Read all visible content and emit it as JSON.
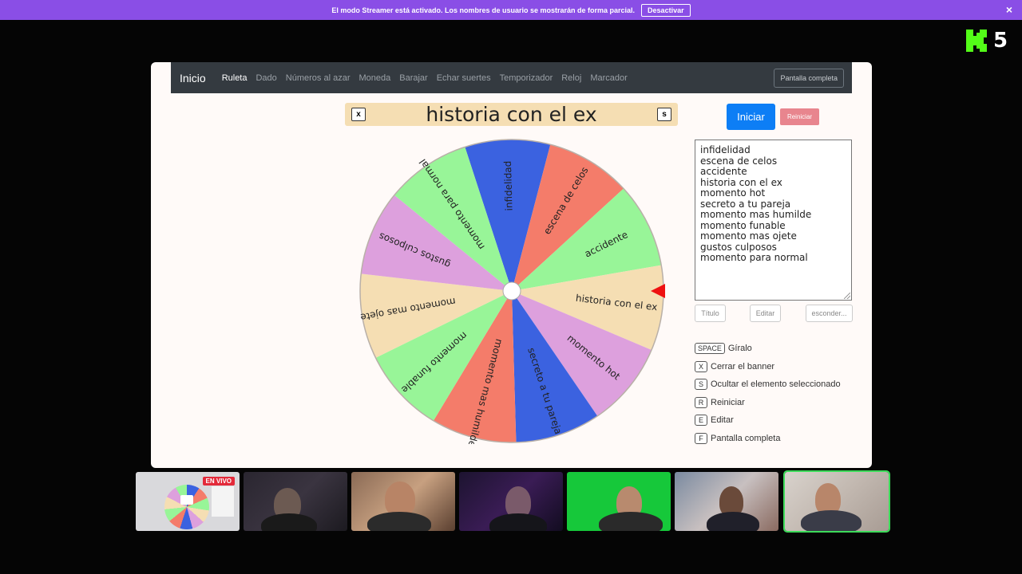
{
  "banner": {
    "message": "El modo Streamer está activado. Los nombres de usuario se mostrarán de forma parcial.",
    "button": "Desactivar",
    "close": "×"
  },
  "kick": {
    "number": "5",
    "color": "#53fc18"
  },
  "nav": {
    "brand": "Inicio",
    "items": [
      "Ruleta",
      "Dado",
      "Números al azar",
      "Moneda",
      "Barajar",
      "Echar suertes",
      "Temporizador",
      "Reloj",
      "Marcador"
    ],
    "fullscreen": "Pantalla completa"
  },
  "selected_title": "historia con el ex",
  "title_keys": {
    "close": "x",
    "hide": "s"
  },
  "buttons": {
    "start": "Iniciar",
    "reset": "Reiniciar"
  },
  "wheel": {
    "segments": [
      {
        "label": "infidelidad",
        "color": "#3b62e0"
      },
      {
        "label": "escena de celos",
        "color": "#f47c6a"
      },
      {
        "label": "accidente",
        "color": "#98f598"
      },
      {
        "label": "historia con el ex",
        "color": "#f5deb3"
      },
      {
        "label": "momento hot",
        "color": "#dda0dd"
      },
      {
        "label": "secreto a tu pareja",
        "color": "#3b62e0"
      },
      {
        "label": "momento mas humilde",
        "color": "#f47c6a"
      },
      {
        "label": "momento funable",
        "color": "#98f598"
      },
      {
        "label": "momento mas ojete",
        "color": "#f5deb3"
      },
      {
        "label": "gustos culposos",
        "color": "#dda0dd"
      },
      {
        "label": "momento para normal",
        "color": "#98f598"
      }
    ],
    "pointer_color": "#ee1111"
  },
  "list_items": [
    "infidelidad",
    "escena de celos",
    "accidente",
    "historia con el ex",
    "momento hot",
    "secreto a tu pareja",
    "momento mas humilde",
    "momento funable",
    "momento mas ojete",
    "gustos culposos",
    "momento para normal"
  ],
  "small_buttons": {
    "title": "Título",
    "edit": "Editar",
    "hide": "esconder..."
  },
  "shortcuts": [
    {
      "key": "SPACE",
      "label": "Gíralo"
    },
    {
      "key": "X",
      "label": "Cerrar el banner"
    },
    {
      "key": "S",
      "label": "Ocultar el elemento seleccionado"
    },
    {
      "key": "R",
      "label": "Reiniciar"
    },
    {
      "key": "E",
      "label": "Editar"
    },
    {
      "key": "F",
      "label": "Pantalla completa"
    }
  ],
  "live_badge": "EN VIVO"
}
